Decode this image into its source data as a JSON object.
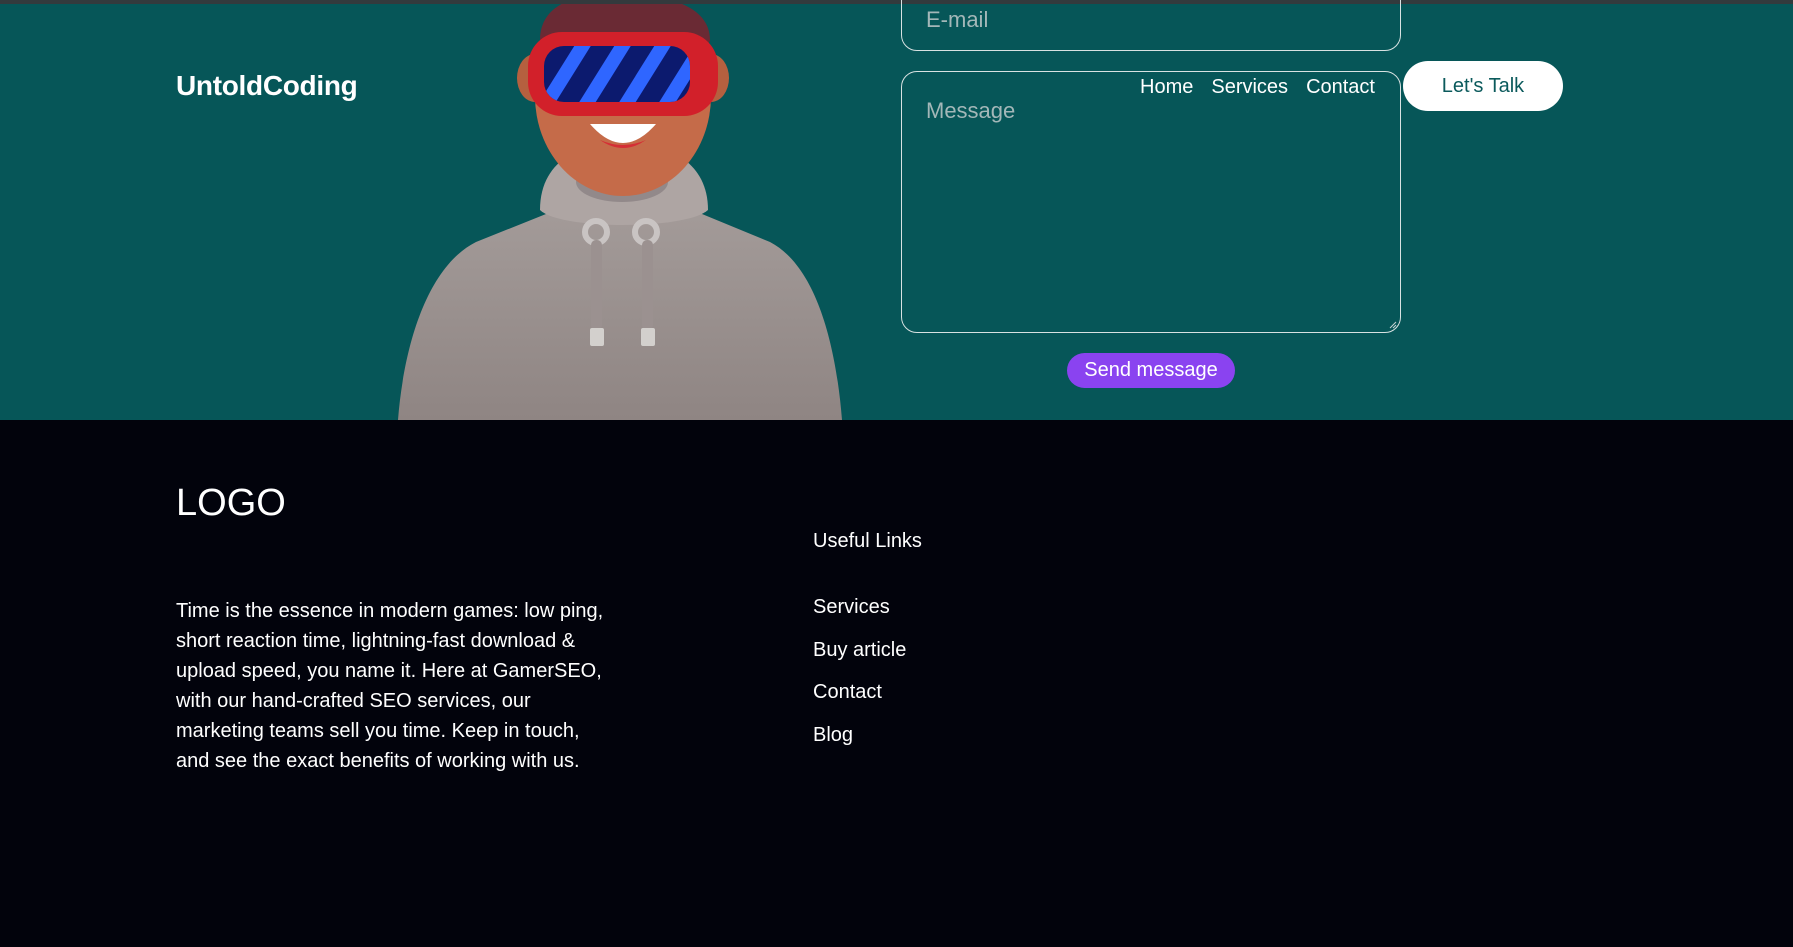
{
  "header": {
    "brand": "UntoldCoding",
    "nav": [
      "Home",
      "Services",
      "Contact"
    ],
    "cta_label": "Let's Talk"
  },
  "contact_form": {
    "email_placeholder": "E-mail",
    "message_placeholder": "Message",
    "send_label": "Send message"
  },
  "footer": {
    "logo": "LOGO",
    "description": "Time is the essence in modern games: low ping, short reaction time, lightning-fast download & upload speed, you name it. Here at GamerSEO, with our hand-crafted SEO services, our marketing teams sell you time. Keep in touch, and see the exact benefits of working with us.",
    "links_heading": "Useful Links",
    "links": [
      "Services",
      "Buy article",
      "Contact",
      "Blog"
    ]
  },
  "colors": {
    "hero_bg": "#065658",
    "footer_bg": "#02030c",
    "send_button": "#8a43f0",
    "cta_bg": "#ffffff"
  },
  "icons": {
    "hero_illustration": "vr-headset-avatar",
    "textarea_grip": "resize-grip-icon"
  }
}
